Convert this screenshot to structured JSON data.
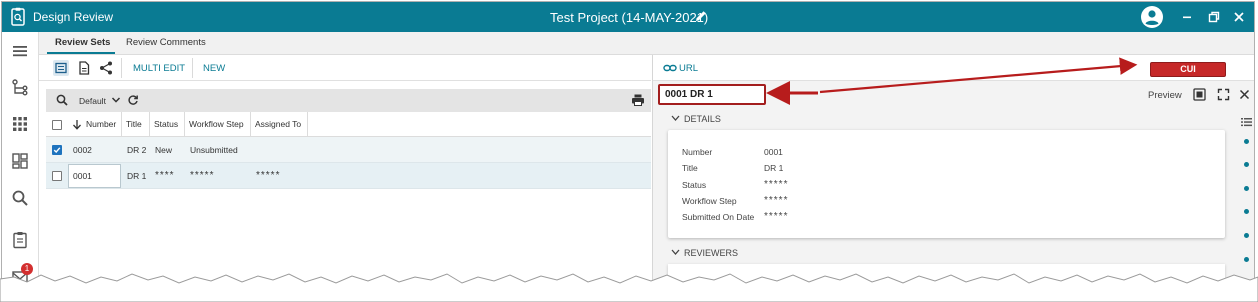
{
  "app": {
    "title": "Design Review",
    "project_title": "Test Project (14-MAY-2021)"
  },
  "tabs": [
    {
      "label": "Review Sets"
    },
    {
      "label": "Review Comments"
    }
  ],
  "toolbar": {
    "multi_edit": "MULTI EDIT",
    "new": "NEW"
  },
  "filter": {
    "label": "Default"
  },
  "columns": {
    "number": "Number",
    "title": "Title",
    "status": "Status",
    "workflow_step": "Workflow Step",
    "assigned_to": "Assigned To"
  },
  "rows": [
    {
      "number": "0002",
      "title": "DR 2",
      "status": "New",
      "workflow_step": "Unsubmitted",
      "assigned_to": "",
      "checked": true
    },
    {
      "number": "0001",
      "title": "DR 1",
      "status": "****",
      "workflow_step": "*****",
      "assigned_to": "*****",
      "checked": false
    }
  ],
  "notifications": {
    "badge_count": "1"
  },
  "detail": {
    "url_label": "URL",
    "classification": "CUI",
    "doc_title": "0001 DR 1",
    "preview_label": "Preview",
    "details_header": "DETAILS",
    "reviewers_header": "REVIEWERS",
    "fields": [
      {
        "label": "Number",
        "value": "0001"
      },
      {
        "label": "Title",
        "value": "DR 1"
      },
      {
        "label": "Status",
        "value": "*****"
      },
      {
        "label": "Workflow Step",
        "value": "*****"
      },
      {
        "label": "Submitted On Date",
        "value": "*****"
      }
    ]
  },
  "colors": {
    "brand": "#0a7b93",
    "cui": "#c62828",
    "callout": "#a31e1e"
  }
}
